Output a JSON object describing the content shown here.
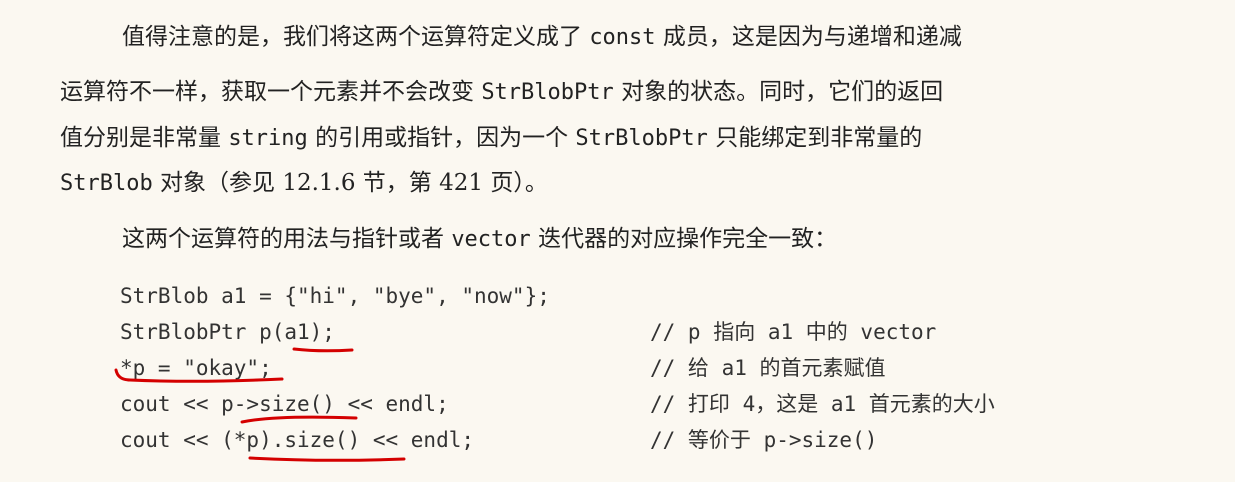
{
  "paragraph1": {
    "line1": {
      "a": "值得注意的是，我们将这两个运算符定义成了",
      "code": "const",
      "b": "成员，这是因为与递增和递减"
    },
    "line2": {
      "a": "运算符不一样，获取一个元素并不会改变",
      "code": "StrBlobPtr",
      "b": "对象的状态。同时，它们的返回"
    },
    "line3": {
      "a": "值分别是非常量",
      "code1": "string",
      "b": "的引用或指针，因为一个",
      "code2": "StrBlobPtr",
      "c": "只能绑定到非常量的"
    },
    "line4": {
      "code": "StrBlob",
      "a": "对象（参见 12.1.6 节，第 421 页）。"
    }
  },
  "paragraph2": {
    "a": "这两个运算符的用法与指针或者",
    "code": "vector",
    "b": "迭代器的对应操作完全一致："
  },
  "code_lines": [
    {
      "stmt": "StrBlob a1 = {\"hi\", \"bye\", \"now\"};",
      "comment": ""
    },
    {
      "stmt": "StrBlobPtr p(a1);",
      "comment": "// p 指向 a1 中的 vector"
    },
    {
      "stmt": "*p = \"okay\";",
      "comment": "// 给 a1 的首元素赋值"
    },
    {
      "stmt": "cout << p->size() << endl;",
      "comment": "// 打印 4，这是 a1 首元素的大小"
    },
    {
      "stmt": "cout << (*p).size() << endl;",
      "comment": "// 等价于 p->size()"
    }
  ],
  "annotation_color": "#d40000"
}
